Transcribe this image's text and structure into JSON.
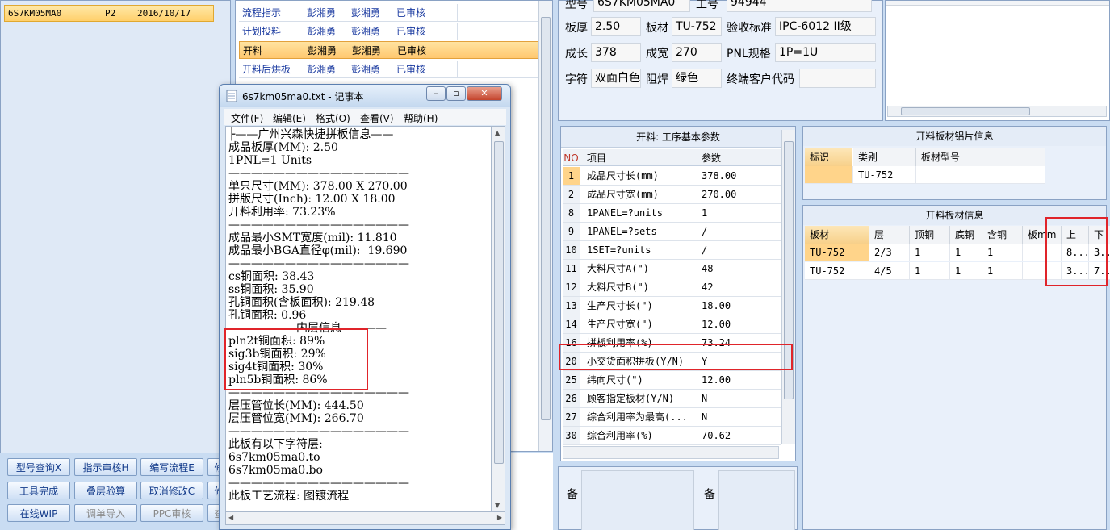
{
  "left_list": {
    "row": {
      "model": "6S7KM05MA0",
      "priority": "P2",
      "date": "2016/10/17"
    }
  },
  "left_buttons": [
    {
      "label": "型号查询X",
      "disabled": false
    },
    {
      "label": "指示审核H",
      "disabled": false
    },
    {
      "label": "编写流程E",
      "disabled": false
    },
    {
      "label": "工具完成",
      "disabled": false
    },
    {
      "label": "叠层验算",
      "disabled": false
    },
    {
      "label": "取消修改C",
      "disabled": false
    },
    {
      "label": "在线WIP",
      "disabled": false
    },
    {
      "label": "调单导入",
      "disabled": true
    },
    {
      "label": "PPC审核",
      "disabled": true
    }
  ],
  "process_rows": [
    {
      "name": "流程指示",
      "p1": "彭湘勇",
      "p2": "彭湘勇",
      "status": "已审核"
    },
    {
      "name": "计划投料",
      "p1": "彭湘勇",
      "p2": "彭湘勇",
      "status": "已审核"
    },
    {
      "name": "开料",
      "p1": "彭湘勇",
      "p2": "彭湘勇",
      "status": "已审核"
    },
    {
      "name": "开料后烘板",
      "p1": "彭湘勇",
      "p2": "彭湘勇",
      "status": "已审核"
    }
  ],
  "info": {
    "model_label": "型号",
    "model_value": "6S7KM05MA0",
    "order_label": "工号",
    "order_value": "94944",
    "thickness_label": "板厚",
    "thickness_value": "2.50",
    "material_label": "板材",
    "material_value": "TU-752",
    "standard_label": "验收标准",
    "standard_value": "IPC-6012 II级",
    "length_label": "成长",
    "length_value": "378",
    "width_label": "成宽",
    "width_value": "270",
    "pnl_label": "PNL规格",
    "pnl_value": "1P=1U",
    "silk_label": "字符",
    "silk_value": "双面白色",
    "mask_label": "阻焊",
    "mask_value": "绿色",
    "customer_label": "终端客户代码",
    "customer_value": ""
  },
  "params": {
    "title": "开料: 工序基本参数",
    "col_no": "NO",
    "col_item": "项目",
    "col_param": "参数",
    "rows": [
      {
        "no": "1",
        "item": "成品尺寸长(mm)",
        "value": "378.00"
      },
      {
        "no": "2",
        "item": "成品尺寸宽(mm)",
        "value": "270.00"
      },
      {
        "no": "8",
        "item": "1PANEL=?units",
        "value": "1"
      },
      {
        "no": "9",
        "item": "1PANEL=?sets",
        "value": "/"
      },
      {
        "no": "10",
        "item": "1SET=?units",
        "value": "/"
      },
      {
        "no": "11",
        "item": "大料尺寸A(\")",
        "value": "48"
      },
      {
        "no": "12",
        "item": "大料尺寸B(\")",
        "value": "42"
      },
      {
        "no": "13",
        "item": "生产尺寸长(\")",
        "value": "18.00"
      },
      {
        "no": "14",
        "item": "生产尺寸宽(\")",
        "value": "12.00"
      },
      {
        "no": "16",
        "item": "拼板利用率(%)",
        "value": "73.24"
      },
      {
        "no": "20",
        "item": "小交货面积拼板(Y/N)",
        "value": "Y"
      },
      {
        "no": "25",
        "item": "纬向尺寸(\")",
        "value": "12.00"
      },
      {
        "no": "26",
        "item": "顾客指定板材(Y/N)",
        "value": "N"
      },
      {
        "no": "27",
        "item": "综合利用率为最高(...",
        "value": "N"
      },
      {
        "no": "30",
        "item": "综合利用率(%)",
        "value": "70.62"
      }
    ]
  },
  "photo_panel": {
    "title": "开料板材铝片信息",
    "headers": [
      "标识",
      "类别",
      "板材型号"
    ],
    "row": [
      "",
      "TU-752",
      ""
    ]
  },
  "mat_panel": {
    "title": "开料板材信息",
    "headers": [
      "板材",
      "层",
      "顶铜",
      "底铜",
      "含铜mm",
      "板mm",
      "上",
      "下"
    ],
    "rows": [
      [
        "TU-752",
        "2/3",
        "1",
        "1",
        "1",
        "",
        "8...",
        "3..."
      ],
      [
        "TU-752",
        "4/5",
        "1",
        "1",
        "1",
        "",
        "3...",
        "7..."
      ]
    ]
  },
  "bottom_mid": {
    "label1": "工艺备",
    "label2": "型号备"
  },
  "notepad": {
    "title": "6s7km05ma0.txt - 记事本",
    "menus": [
      "文件(F)",
      "编辑(E)",
      "格式(O)",
      "查看(V)",
      "帮助(H)"
    ],
    "lines": [
      "├——广州兴森快捷拼板信息——",
      "成品板厚(MM): 2.50",
      "1PNL=1 Units",
      "————————————————",
      "单只尺寸(MM): 378.00 X 270.00",
      "拼版尺寸(Inch): 12.00 X 18.00",
      "开料利用率: 73.23%",
      "————————————————",
      "成品最小SMT宽度(mil): 11.810",
      "成品最小BGA直径φ(mil):  19.690",
      "————————————————",
      "cs铜面积: 38.43",
      "ss铜面积: 35.90",
      "孔铜面积(含板面积): 219.48",
      "孔铜面积: 0.96",
      "——————内层信息————",
      "pln2t铜面积: 89%",
      "sig3b铜面积: 29%",
      "sig4t铜面积: 30%",
      "pln5b铜面积: 86%",
      "————————————————",
      "层压管位长(MM): 444.50",
      "层压管位宽(MM): 266.70",
      "————————————————",
      "此板有以下字符层:",
      "6s7km05ma0.to",
      "6s7km05ma0.bo",
      "————————————————",
      "此板工艺流程: 图镀流程"
    ]
  },
  "colors": {
    "accent_row": "#ffc870",
    "highlight_box": "#e0242a",
    "link_text": "#1a3aa0"
  }
}
